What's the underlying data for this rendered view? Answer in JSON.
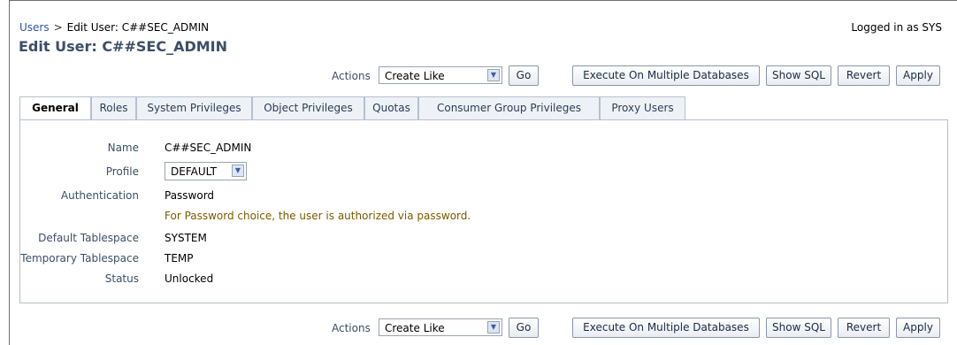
{
  "breadcrumb": {
    "users": "Users",
    "sep": ">",
    "current": "Edit User: C##SEC_ADMIN"
  },
  "page": {
    "title": "Edit User: C##SEC_ADMIN",
    "logged_in": "Logged in as SYS"
  },
  "actions": {
    "label": "Actions",
    "selected": "Create Like",
    "go": "Go",
    "execute": "Execute On Multiple Databases",
    "show_sql": "Show SQL",
    "revert": "Revert",
    "apply": "Apply"
  },
  "tabs": [
    {
      "label": "General",
      "active": true
    },
    {
      "label": "Roles"
    },
    {
      "label": "System Privileges"
    },
    {
      "label": "Object Privileges"
    },
    {
      "label": "Quotas"
    },
    {
      "label": "Consumer Group Privileges"
    },
    {
      "label": "Proxy Users"
    }
  ],
  "form": {
    "name_label": "Name",
    "name_value": "C##SEC_ADMIN",
    "profile_label": "Profile",
    "profile_value": "DEFAULT",
    "auth_label": "Authentication",
    "auth_value": "Password",
    "auth_hint": "For Password choice, the user is authorized via password.",
    "default_ts_label": "Default Tablespace",
    "default_ts_value": "SYSTEM",
    "temp_ts_label": "Temporary Tablespace",
    "temp_ts_value": "TEMP",
    "status_label": "Status",
    "status_value": "Unlocked"
  },
  "colors": {
    "title": "#3b4f68",
    "link": "#2b57a6",
    "hint": "#7a5b00",
    "border": "#b5c0cf"
  }
}
